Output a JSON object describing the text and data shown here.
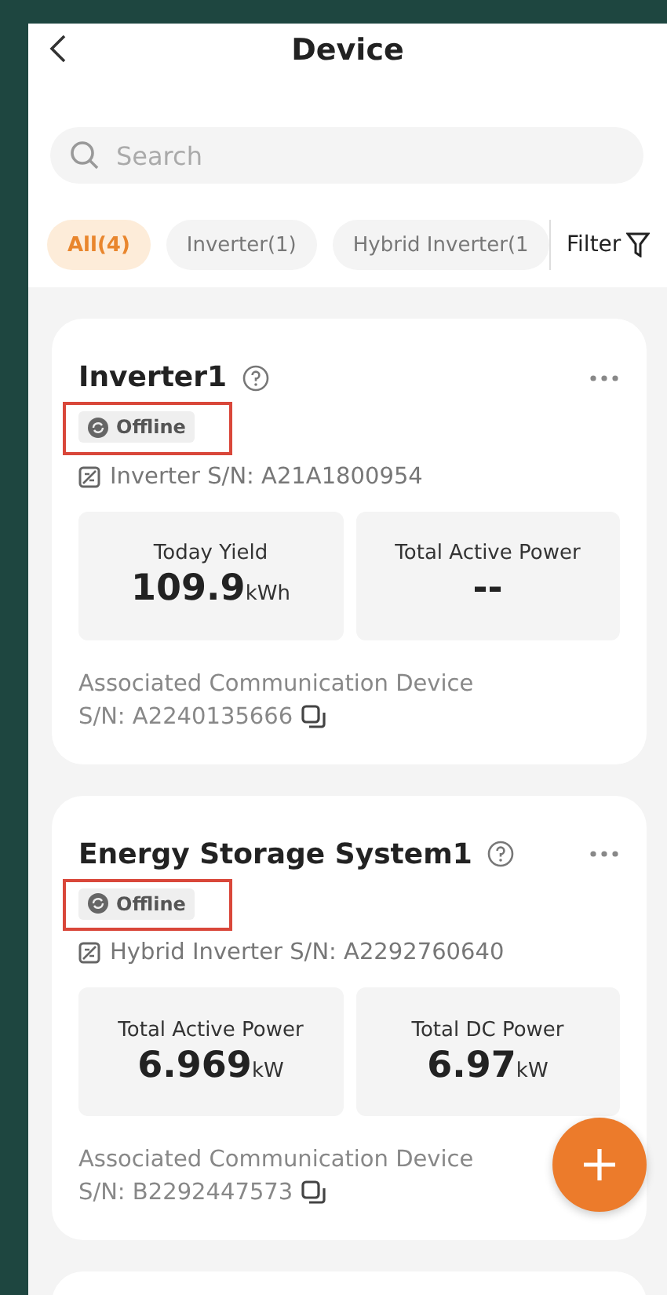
{
  "header": {
    "title": "Device"
  },
  "search": {
    "placeholder": "Search"
  },
  "tabs": [
    {
      "label": "All(4)",
      "selected": true
    },
    {
      "label": "Inverter(1)",
      "selected": false
    },
    {
      "label": "Hybrid Inverter(1",
      "selected": false
    }
  ],
  "filter": {
    "label": "Filter"
  },
  "devices": [
    {
      "name": "Inverter1",
      "status": "Offline",
      "highlighted": true,
      "serial": "Inverter S/N: A21A1800954",
      "metrics": [
        {
          "label": "Today Yield",
          "value": "109.9",
          "unit": "kWh"
        },
        {
          "label": "Total Active Power",
          "value": "--"
        }
      ],
      "comm_label": "Associated Communication Device",
      "comm_serial": "S/N: A2240135666"
    },
    {
      "name": "Energy Storage System1",
      "status": "Offline",
      "highlighted": true,
      "serial": "Hybrid Inverter S/N: A2292760640",
      "metrics": [
        {
          "label": "Total Active Power",
          "value": "6.969",
          "unit": "kW"
        },
        {
          "label": "Total DC Power",
          "value": "6.97",
          "unit": "kW"
        }
      ],
      "comm_label": "Associated Communication Device",
      "comm_serial": "S/N: B2292447573"
    }
  ]
}
